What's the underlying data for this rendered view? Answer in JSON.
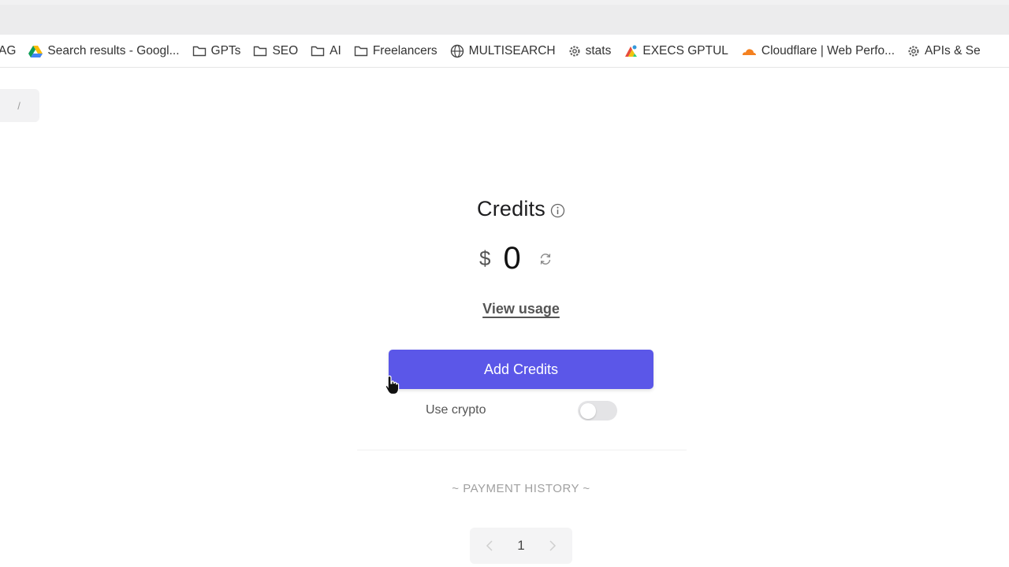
{
  "bookmarks": [
    {
      "label": "AG",
      "icon": "none"
    },
    {
      "label": "Search results - Googl...",
      "icon": "google-drive-icon"
    },
    {
      "label": "GPTs",
      "icon": "folder-icon"
    },
    {
      "label": "SEO",
      "icon": "folder-icon"
    },
    {
      "label": "AI",
      "icon": "folder-icon"
    },
    {
      "label": "Freelancers",
      "icon": "folder-icon"
    },
    {
      "label": "MULTISEARCH",
      "icon": "globe-icon"
    },
    {
      "label": "stats",
      "icon": "gear-icon"
    },
    {
      "label": "EXECS GPTUL",
      "icon": "app-icon"
    },
    {
      "label": "Cloudflare | Web Perfo...",
      "icon": "cloudflare-icon"
    },
    {
      "label": "APIs & Se",
      "icon": "gear-icon"
    }
  ],
  "shortcut_key": "/",
  "credits": {
    "title": "Credits",
    "currency": "$",
    "amount": "0",
    "view_usage": "View usage",
    "add_button": "Add Credits",
    "use_crypto_label": "Use crypto",
    "use_crypto_enabled": false
  },
  "payment_history": {
    "heading": "~ PAYMENT HISTORY ~",
    "page": "1"
  },
  "colors": {
    "accent": "#5b57e8",
    "toggle_off": "#e4e4e6"
  }
}
